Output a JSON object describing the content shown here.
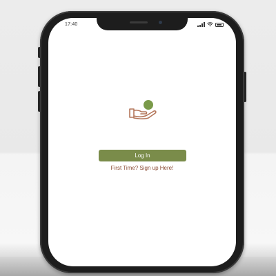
{
  "status_bar": {
    "time": "17:40",
    "signal_icon": "signal-icon",
    "wifi_icon": "wifi-icon",
    "battery_icon": "battery-icon"
  },
  "logo": {
    "icon": "hand-holding-coin-icon",
    "colors": {
      "coin": "#7a9a4a",
      "hand": "#b4765a"
    }
  },
  "login": {
    "button_label": "Log In",
    "color": "#7a8c4a"
  },
  "signup": {
    "link_label": "First Time? Sign up Here!",
    "color": "#8a4a33"
  }
}
